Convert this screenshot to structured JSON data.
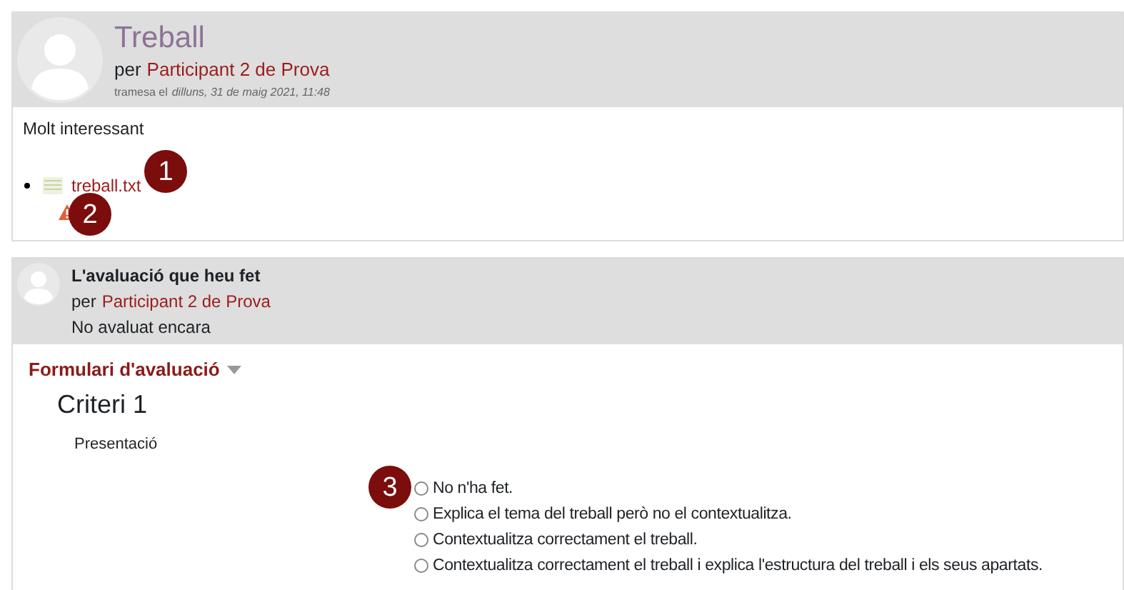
{
  "submission": {
    "title": "Treball",
    "author_prefix": "per",
    "author": "Participant 2 de Prova",
    "date_prefix": "tramesa el",
    "date": "dilluns, 31 de maig 2021, 11:48",
    "content": "Molt interessant",
    "attachments": [
      {
        "name": "treball.txt",
        "warning": true
      }
    ]
  },
  "assessment": {
    "title": "L'avaluació que heu fet",
    "author_prefix": "per",
    "author": "Participant 2 de Prova",
    "status": "No avaluat encara",
    "form_title": "Formulari d'avaluació",
    "expanded": true,
    "criteria": [
      {
        "title": "Criteri 1",
        "description": "Presentació",
        "options": [
          {
            "label": "No n'ha fet.",
            "selected": false
          },
          {
            "label": "Explica el tema del treball però no el contextualitza.",
            "selected": false
          },
          {
            "label": "Contextualitza correctament el treball.",
            "selected": false
          },
          {
            "label": "Contextualitza correctament el treball i explica l'estructura del treball i els seus apartats.",
            "selected": false
          }
        ]
      }
    ]
  },
  "callouts": [
    "1",
    "2",
    "3"
  ]
}
